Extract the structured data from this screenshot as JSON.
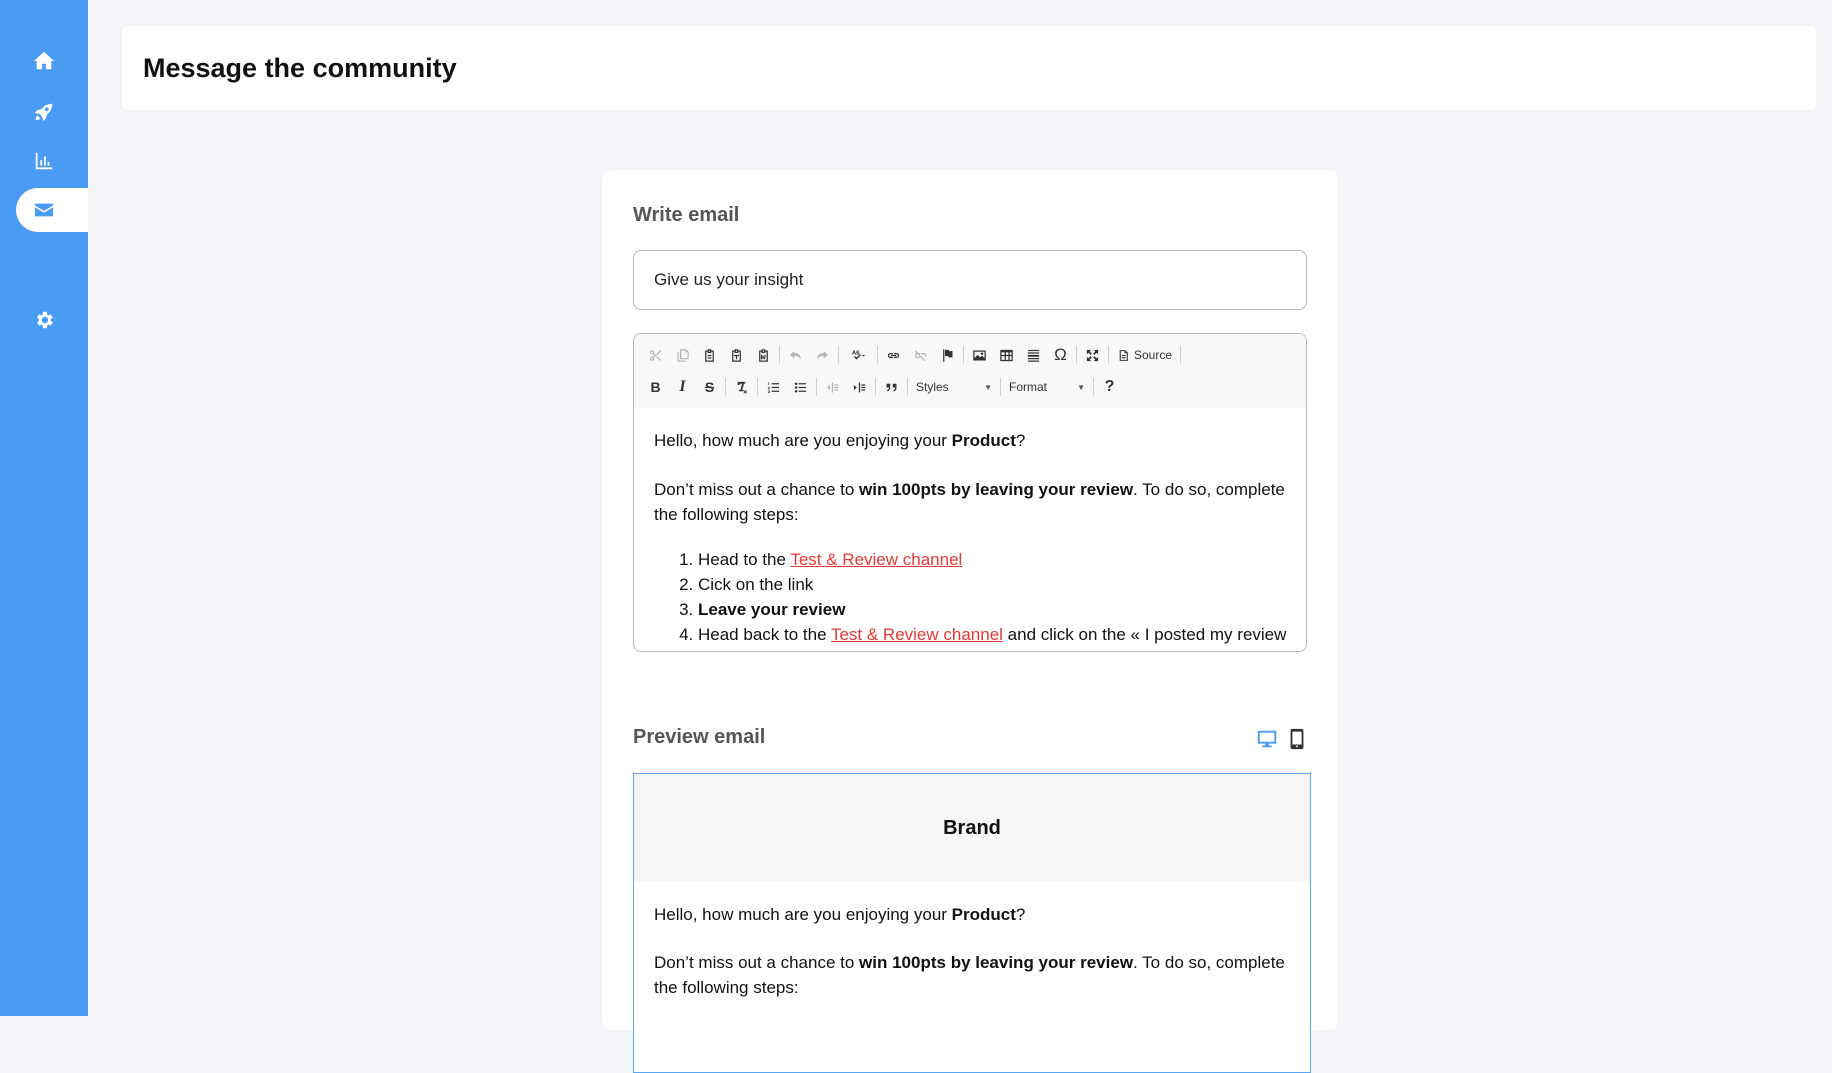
{
  "sidebar": {
    "items": [
      {
        "name": "home",
        "icon": "home-icon"
      },
      {
        "name": "campaigns",
        "icon": "rocket-icon"
      },
      {
        "name": "analytics",
        "icon": "bar-chart-icon"
      },
      {
        "name": "messages",
        "icon": "mail-icon",
        "active": true
      },
      {
        "name": "settings",
        "icon": "gear-icon"
      }
    ],
    "accent": "#4a9bf3"
  },
  "header": {
    "title": "Message the community"
  },
  "write": {
    "title": "Write email",
    "subject_value": "Give us your insight",
    "toolbar": {
      "source_label": "Source",
      "styles_label": "Styles",
      "format_label": "Format"
    },
    "body": {
      "line1_pre": "Hello, how much are you enjoying your ",
      "line1_bold": "Product",
      "line1_post": "?",
      "line2_pre": "Don’t miss out a chance to ",
      "line2_bold": "win 100pts by leaving your review",
      "line2_post": ". To do so, complete the following steps:",
      "steps": {
        "s1_pre": "Head to the ",
        "s1_link": "Test & Review channel",
        "s2": "Cick on the link",
        "s3": "Leave your review",
        "s4_pre": "Head back to the ",
        "s4_link": "Test & Review channel",
        "s4_post": " and click on the « I posted my review » button"
      }
    }
  },
  "preview": {
    "title": "Preview email",
    "brand": "Brand",
    "line1_pre": "Hello, how much are you enjoying your ",
    "line1_bold": "Product",
    "line1_post": "?",
    "line2_pre": "Don’t miss out a chance to ",
    "line2_bold": "win 100pts by leaving your review",
    "line2_post": ". To do so, complete the following steps:",
    "active_device": "desktop"
  },
  "colors": {
    "link": "#e53935",
    "preview_border": "#5aa5f0"
  }
}
